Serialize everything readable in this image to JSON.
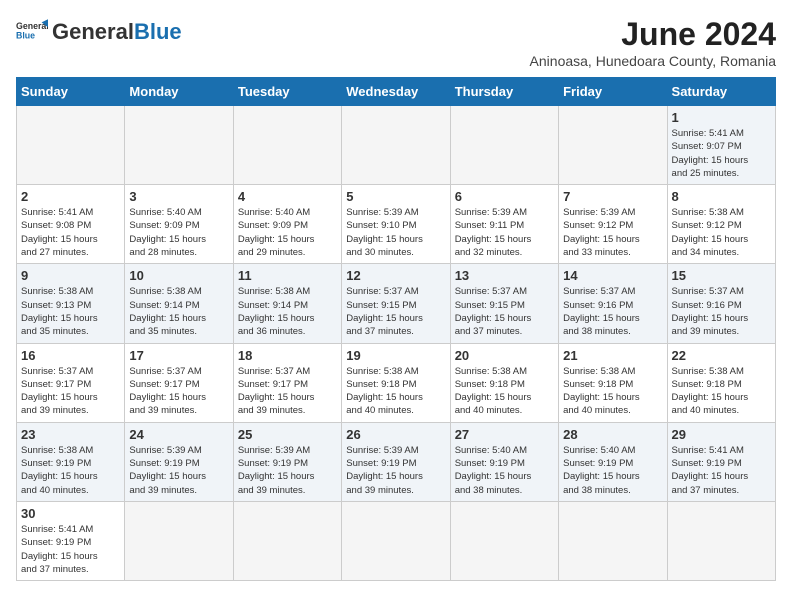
{
  "header": {
    "logo_general": "General",
    "logo_blue": "Blue",
    "title": "June 2024",
    "subtitle": "Aninoasa, Hunedoara County, Romania"
  },
  "weekdays": [
    "Sunday",
    "Monday",
    "Tuesday",
    "Wednesday",
    "Thursday",
    "Friday",
    "Saturday"
  ],
  "weeks": [
    [
      {
        "day": "",
        "info": ""
      },
      {
        "day": "",
        "info": ""
      },
      {
        "day": "",
        "info": ""
      },
      {
        "day": "",
        "info": ""
      },
      {
        "day": "",
        "info": ""
      },
      {
        "day": "",
        "info": ""
      },
      {
        "day": "1",
        "info": "Sunrise: 5:41 AM\nSunset: 9:07 PM\nDaylight: 15 hours\nand 25 minutes."
      }
    ],
    [
      {
        "day": "2",
        "info": "Sunrise: 5:41 AM\nSunset: 9:08 PM\nDaylight: 15 hours\nand 27 minutes."
      },
      {
        "day": "3",
        "info": "Sunrise: 5:40 AM\nSunset: 9:09 PM\nDaylight: 15 hours\nand 28 minutes."
      },
      {
        "day": "4",
        "info": "Sunrise: 5:40 AM\nSunset: 9:09 PM\nDaylight: 15 hours\nand 29 minutes."
      },
      {
        "day": "5",
        "info": "Sunrise: 5:39 AM\nSunset: 9:10 PM\nDaylight: 15 hours\nand 30 minutes."
      },
      {
        "day": "6",
        "info": "Sunrise: 5:39 AM\nSunset: 9:11 PM\nDaylight: 15 hours\nand 32 minutes."
      },
      {
        "day": "7",
        "info": "Sunrise: 5:39 AM\nSunset: 9:12 PM\nDaylight: 15 hours\nand 33 minutes."
      },
      {
        "day": "8",
        "info": "Sunrise: 5:38 AM\nSunset: 9:12 PM\nDaylight: 15 hours\nand 34 minutes."
      }
    ],
    [
      {
        "day": "9",
        "info": "Sunrise: 5:38 AM\nSunset: 9:13 PM\nDaylight: 15 hours\nand 35 minutes."
      },
      {
        "day": "10",
        "info": "Sunrise: 5:38 AM\nSunset: 9:14 PM\nDaylight: 15 hours\nand 35 minutes."
      },
      {
        "day": "11",
        "info": "Sunrise: 5:38 AM\nSunset: 9:14 PM\nDaylight: 15 hours\nand 36 minutes."
      },
      {
        "day": "12",
        "info": "Sunrise: 5:37 AM\nSunset: 9:15 PM\nDaylight: 15 hours\nand 37 minutes."
      },
      {
        "day": "13",
        "info": "Sunrise: 5:37 AM\nSunset: 9:15 PM\nDaylight: 15 hours\nand 37 minutes."
      },
      {
        "day": "14",
        "info": "Sunrise: 5:37 AM\nSunset: 9:16 PM\nDaylight: 15 hours\nand 38 minutes."
      },
      {
        "day": "15",
        "info": "Sunrise: 5:37 AM\nSunset: 9:16 PM\nDaylight: 15 hours\nand 39 minutes."
      }
    ],
    [
      {
        "day": "16",
        "info": "Sunrise: 5:37 AM\nSunset: 9:17 PM\nDaylight: 15 hours\nand 39 minutes."
      },
      {
        "day": "17",
        "info": "Sunrise: 5:37 AM\nSunset: 9:17 PM\nDaylight: 15 hours\nand 39 minutes."
      },
      {
        "day": "18",
        "info": "Sunrise: 5:37 AM\nSunset: 9:17 PM\nDaylight: 15 hours\nand 39 minutes."
      },
      {
        "day": "19",
        "info": "Sunrise: 5:38 AM\nSunset: 9:18 PM\nDaylight: 15 hours\nand 40 minutes."
      },
      {
        "day": "20",
        "info": "Sunrise: 5:38 AM\nSunset: 9:18 PM\nDaylight: 15 hours\nand 40 minutes."
      },
      {
        "day": "21",
        "info": "Sunrise: 5:38 AM\nSunset: 9:18 PM\nDaylight: 15 hours\nand 40 minutes."
      },
      {
        "day": "22",
        "info": "Sunrise: 5:38 AM\nSunset: 9:18 PM\nDaylight: 15 hours\nand 40 minutes."
      }
    ],
    [
      {
        "day": "23",
        "info": "Sunrise: 5:38 AM\nSunset: 9:19 PM\nDaylight: 15 hours\nand 40 minutes."
      },
      {
        "day": "24",
        "info": "Sunrise: 5:39 AM\nSunset: 9:19 PM\nDaylight: 15 hours\nand 39 minutes."
      },
      {
        "day": "25",
        "info": "Sunrise: 5:39 AM\nSunset: 9:19 PM\nDaylight: 15 hours\nand 39 minutes."
      },
      {
        "day": "26",
        "info": "Sunrise: 5:39 AM\nSunset: 9:19 PM\nDaylight: 15 hours\nand 39 minutes."
      },
      {
        "day": "27",
        "info": "Sunrise: 5:40 AM\nSunset: 9:19 PM\nDaylight: 15 hours\nand 38 minutes."
      },
      {
        "day": "28",
        "info": "Sunrise: 5:40 AM\nSunset: 9:19 PM\nDaylight: 15 hours\nand 38 minutes."
      },
      {
        "day": "29",
        "info": "Sunrise: 5:41 AM\nSunset: 9:19 PM\nDaylight: 15 hours\nand 37 minutes."
      }
    ],
    [
      {
        "day": "30",
        "info": "Sunrise: 5:41 AM\nSunset: 9:19 PM\nDaylight: 15 hours\nand 37 minutes."
      },
      {
        "day": "",
        "info": ""
      },
      {
        "day": "",
        "info": ""
      },
      {
        "day": "",
        "info": ""
      },
      {
        "day": "",
        "info": ""
      },
      {
        "day": "",
        "info": ""
      },
      {
        "day": "",
        "info": ""
      }
    ]
  ]
}
